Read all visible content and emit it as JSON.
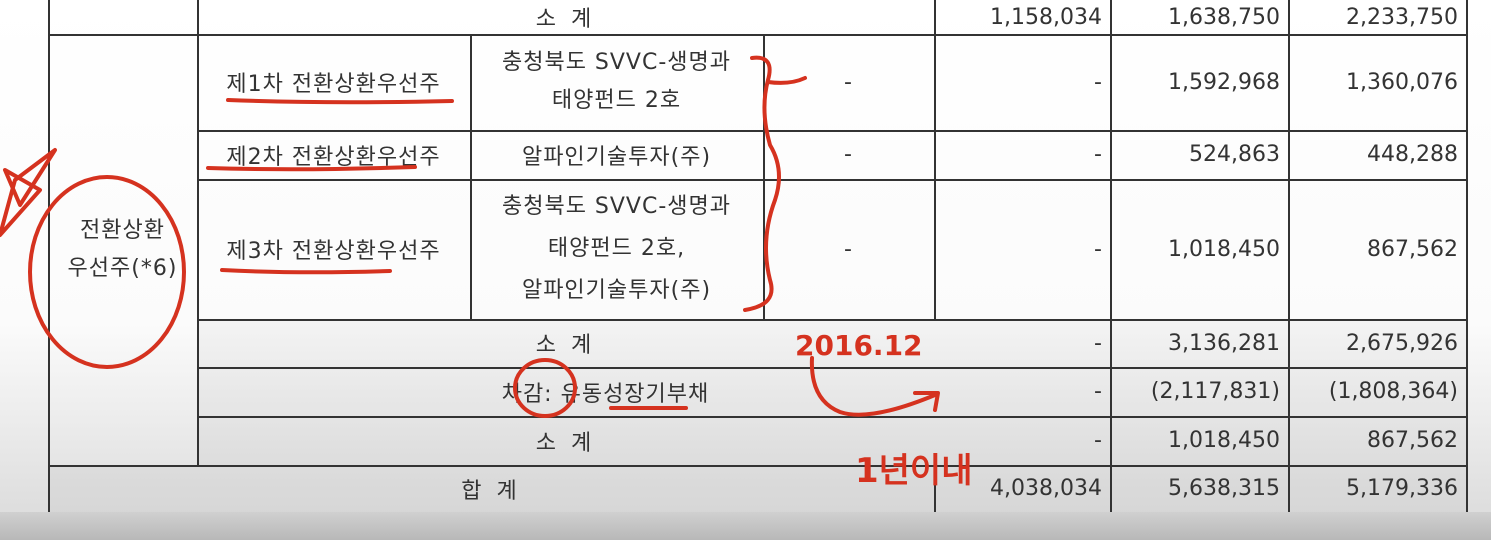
{
  "row_subtotal_1": {
    "label": "소     계",
    "values": [
      "1,158,034",
      "1,638,750",
      "2,233,750"
    ]
  },
  "group": {
    "label_line1": "전환상환",
    "label_line2": "우선주(*6)"
  },
  "series_rows": [
    {
      "name": "제1차 전환상환우선주",
      "investor_lines": [
        "충청북도 SVVC-생명과",
        "태양펀드 2호"
      ],
      "c1": "-",
      "c2": "-",
      "c3": "1,592,968",
      "c4": "1,360,076"
    },
    {
      "name": "제2차 전환상환우선주",
      "investor_lines": [
        "알파인기술투자(주)"
      ],
      "c1": "-",
      "c2": "-",
      "c3": "524,863",
      "c4": "448,288"
    },
    {
      "name": "제3차 전환상환우선주",
      "investor_lines": [
        "충청북도 SVVC-생명과",
        "태양펀드 2호,",
        "알파인기술투자(주)"
      ],
      "c1": "-",
      "c2": "-",
      "c3": "1,018,450",
      "c4": "867,562"
    }
  ],
  "subtotal_2": {
    "label": "소     계",
    "c2": "-",
    "c3": "3,136,281",
    "c4": "2,675,926"
  },
  "deduction": {
    "label": "차감: 유동성장기부채",
    "c2": "-",
    "c3": "(2,117,831)",
    "c4": "(1,808,364)"
  },
  "subtotal_3": {
    "label": "소     계",
    "c2": "-",
    "c3": "1,018,450",
    "c4": "867,562"
  },
  "total": {
    "label": "합     계",
    "c2": "4,038,034",
    "c3": "5,638,315",
    "c4": "5,179,336"
  },
  "annotations": {
    "date_note": "2016.12",
    "within_note": "1년이내",
    "ink_color": "#d5321f"
  }
}
